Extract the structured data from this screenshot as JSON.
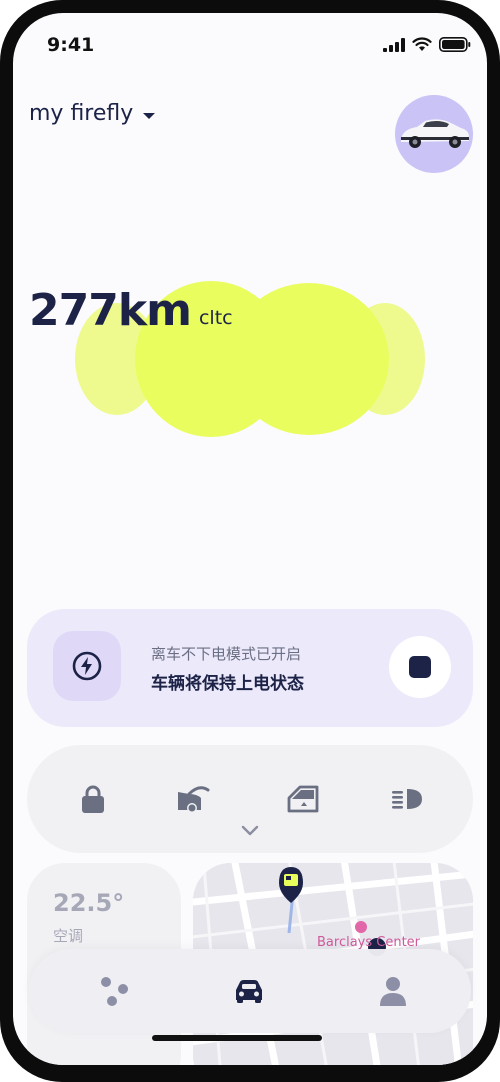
{
  "status_bar": {
    "time": "9:41"
  },
  "header": {
    "title": "my firefly"
  },
  "range": {
    "value": "277km",
    "unit": "cltc"
  },
  "power_mode": {
    "subtitle": "离车不下电模式已开启",
    "title": "车辆将保持上电状态"
  },
  "controls": {
    "items": [
      "lock-icon",
      "trunk-icon",
      "window-icon",
      "headlight-icon"
    ]
  },
  "climate": {
    "temperature": "22.5°",
    "label": "空调"
  },
  "map": {
    "poi_label": "Barclays Center"
  },
  "tabbar": {
    "items": [
      "dots-icon",
      "car-icon",
      "profile-icon"
    ],
    "active": 1
  },
  "colors": {
    "accent": "#e8fe5a",
    "navy": "#1c2347",
    "lavender": "#ece9fb"
  }
}
